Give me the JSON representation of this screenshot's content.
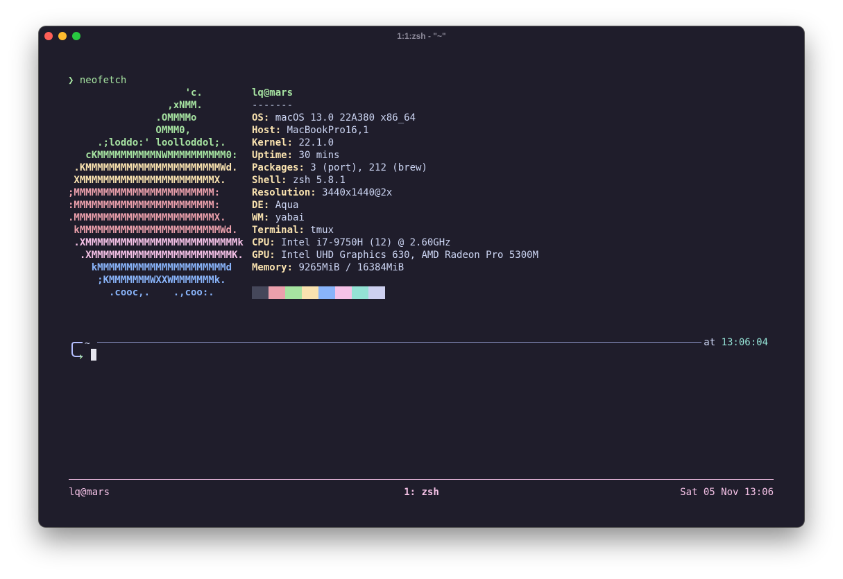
{
  "window": {
    "title": "1:1:zsh - \"~\""
  },
  "terminal": {
    "prompt_symbol": "❯",
    "command": "neofetch",
    "ascii_art": [
      {
        "text": "                    'c.",
        "color": "#a6e3a1"
      },
      {
        "text": "                 ,xNMM.",
        "color": "#a6e3a1"
      },
      {
        "text": "               .OMMMMo",
        "color": "#a6e3a1"
      },
      {
        "text": "               OMMM0,",
        "color": "#a6e3a1"
      },
      {
        "text": "     .;loddo:' loolloddol;.",
        "color": "#a6e3a1"
      },
      {
        "text": "   cKMMMMMMMMMMNWMMMMMMMMMM0:",
        "color": "#a6e3a1"
      },
      {
        "text": " .KMMMMMMMMMMMMMMMMMMMMMMMWd.",
        "color": "#f9e2af"
      },
      {
        "text": " XMMMMMMMMMMMMMMMMMMMMMMMX.",
        "color": "#f9e2af"
      },
      {
        "text": ";MMMMMMMMMMMMMMMMMMMMMMMM:",
        "color": "#eba0ac"
      },
      {
        "text": ":MMMMMMMMMMMMMMMMMMMMMMMM:",
        "color": "#eba0ac"
      },
      {
        "text": ".MMMMMMMMMMMMMMMMMMMMMMMMX.",
        "color": "#eba0ac"
      },
      {
        "text": " kMMMMMMMMMMMMMMMMMMMMMMMMWd.",
        "color": "#eba0ac"
      },
      {
        "text": " .XMMMMMMMMMMMMMMMMMMMMMMMMMMk",
        "color": "#f5c2e7"
      },
      {
        "text": "  .XMMMMMMMMMMMMMMMMMMMMMMMMK.",
        "color": "#f5c2e7"
      },
      {
        "text": "    kMMMMMMMMMMMMMMMMMMMMMMd",
        "color": "#89b4fa"
      },
      {
        "text": "     ;KMMMMMMMWXXWMMMMMMMk.",
        "color": "#89b4fa"
      },
      {
        "text": "       .cooc,.    .,coo:.",
        "color": "#89b4fa"
      }
    ],
    "info_title": "lq@mars",
    "info_separator": "-------",
    "info": [
      {
        "key": "OS",
        "value": "macOS 13.0 22A380 x86_64"
      },
      {
        "key": "Host",
        "value": "MacBookPro16,1"
      },
      {
        "key": "Kernel",
        "value": "22.1.0"
      },
      {
        "key": "Uptime",
        "value": "30 mins"
      },
      {
        "key": "Packages",
        "value": "3 (port), 212 (brew)"
      },
      {
        "key": "Shell",
        "value": "zsh 5.8.1"
      },
      {
        "key": "Resolution",
        "value": "3440x1440@2x"
      },
      {
        "key": "DE",
        "value": "Aqua"
      },
      {
        "key": "WM",
        "value": "yabai"
      },
      {
        "key": "Terminal",
        "value": "tmux"
      },
      {
        "key": "CPU",
        "value": "Intel i7-9750H (12) @ 2.60GHz"
      },
      {
        "key": "GPU",
        "value": "Intel UHD Graphics 630, AMD Radeon Pro 5300M"
      },
      {
        "key": "Memory",
        "value": "9265MiB / 16384MiB"
      }
    ],
    "palette": [
      "#45475a",
      "#eba0ac",
      "#a6e3a1",
      "#f9e2af",
      "#89b4fa",
      "#f5c2e7",
      "#94e2d5",
      "#cdd0f0"
    ],
    "cwd": "~",
    "at_label": "at",
    "time": "13:06:04"
  },
  "statusbar": {
    "session": "lq@mars",
    "window": "1: zsh",
    "datetime": "Sat 05 Nov 13:06"
  }
}
